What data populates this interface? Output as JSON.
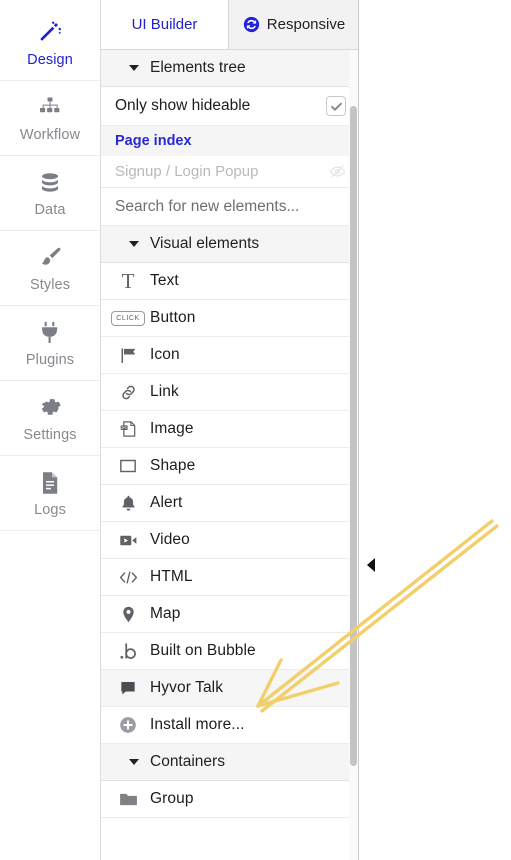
{
  "rail": {
    "items": [
      {
        "label": "Design",
        "icon": "magic-wand-icon",
        "active": true
      },
      {
        "label": "Workflow",
        "icon": "sitemap-icon",
        "active": false
      },
      {
        "label": "Data",
        "icon": "database-icon",
        "active": false
      },
      {
        "label": "Styles",
        "icon": "paintbrush-icon",
        "active": false
      },
      {
        "label": "Plugins",
        "icon": "plug-icon",
        "active": false
      },
      {
        "label": "Settings",
        "icon": "gear-icon",
        "active": false
      },
      {
        "label": "Logs",
        "icon": "document-icon",
        "active": false
      }
    ]
  },
  "tabs": {
    "ui_builder": "UI Builder",
    "responsive": "Responsive",
    "responsive_icon": "sync-circle-icon"
  },
  "elements_tree": {
    "title": "Elements tree",
    "only_show_hideable": "Only show hideable",
    "only_show_hideable_checked": true,
    "page_index": "Page index",
    "sub_page": "Signup / Login Popup",
    "sub_page_icon": "eye-off-icon",
    "search_placeholder": "Search for new elements..."
  },
  "visual_elements": {
    "title": "Visual elements",
    "items": [
      {
        "label": "Text",
        "icon": "serif-t-icon"
      },
      {
        "label": "Button",
        "icon": "click-button-icon"
      },
      {
        "label": "Icon",
        "icon": "flag-icon"
      },
      {
        "label": "Link",
        "icon": "chain-link-icon"
      },
      {
        "label": "Image",
        "icon": "image-jpg-icon"
      },
      {
        "label": "Shape",
        "icon": "square-outline-icon"
      },
      {
        "label": "Alert",
        "icon": "bell-icon"
      },
      {
        "label": "Video",
        "icon": "video-camera-icon"
      },
      {
        "label": "HTML",
        "icon": "code-brackets-icon"
      },
      {
        "label": "Map",
        "icon": "map-pin-icon"
      },
      {
        "label": "Built on Bubble",
        "icon": "bubble-b-icon"
      },
      {
        "label": "Hyvor Talk",
        "icon": "speech-bubble-icon",
        "highlighted": true
      },
      {
        "label": "Install more...",
        "icon": "plus-circle-icon"
      }
    ]
  },
  "containers": {
    "title": "Containers",
    "items": [
      {
        "label": "Group",
        "icon": "folder-icon"
      }
    ]
  },
  "canvas": {
    "collapse_icon": "collapse-left-arrow-icon",
    "annotation": "yellow-arrow-pointing-to-hyvor-talk"
  },
  "colors": {
    "accent_blue": "#2222cc",
    "annotation_yellow": "#f2cf6b",
    "icon_gray": "#5f6368",
    "section_bg": "#f5f5f5"
  }
}
